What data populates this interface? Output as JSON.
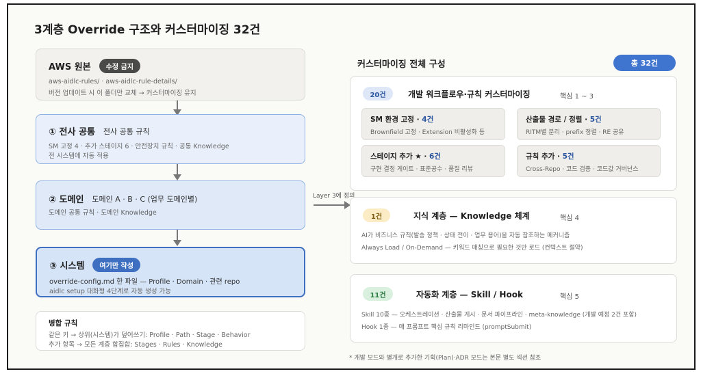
{
  "title": "3계층 Override 구조와 커스터마이징 32건",
  "layers": [
    {
      "name": "AWS 원본",
      "badge": "수정 금지",
      "subtitle": "",
      "lines": [
        "aws-aidlc-rules/ · aws-aidlc-rule-details/",
        "버전 업데이트 시 이 폴더만 교체 → 커스터마이징 유지"
      ]
    },
    {
      "name": "① 전사 공통",
      "badge": "",
      "subtitle": "전사 공통 규칙",
      "lines": [
        "SM 고정 4 · 추가 스테이지 6 · 안전장치 규칙 · 공통 Knowledge",
        "전 시스템에 자동 적용"
      ]
    },
    {
      "name": "② 도메인",
      "badge": "",
      "subtitle": "도메인 A · B · C (업무 도메인별)",
      "lines": [
        "도메인 공통 규칙 · 도메인 Knowledge"
      ]
    },
    {
      "name": "③ 시스템",
      "badge": "여기만 작성",
      "subtitle": "",
      "lines": [
        "override-config.md 한 파일 — Profile · Domain · 관련 repo",
        "aidlc setup 대화형 4단계로 자동 생성 가능"
      ]
    }
  ],
  "merge": {
    "title": "병합 규칙",
    "lines": [
      "같은 키 → 상위(시스템)가 덮어쓰기: Profile · Path · Stage · Behavior",
      "추가 항목 → 모든 계층 합집합: Stages · Rules · Knowledge"
    ]
  },
  "connector_label": "Layer 3에 정의",
  "right": {
    "title": "커스터마이징 전체 구성",
    "total": "총 32건",
    "sections": [
      {
        "count": "20건",
        "name": "개발 워크플로우·규칙 커스터마이징",
        "core": "핵심 1 ~ 3",
        "items": [
          {
            "title": "SM 환경 고정 · ",
            "count": "4건",
            "desc": "Brownfield 고정 · Extension 비활성화 등"
          },
          {
            "title": "산출물 경로 / 정렬 · ",
            "count": "5건",
            "desc": "RITM별 분리 · prefix 정렬 · RE 공유"
          },
          {
            "title": "스테이지 추가 ★ · ",
            "count": "6건",
            "desc": "구현 결정 게이트 · 표준공수 · 품질 리뷰"
          },
          {
            "title": "규칙 추가 · ",
            "count": "5건",
            "desc": "Cross-Repo · 코드 검증 · 코드값 거버넌스"
          }
        ]
      },
      {
        "count": "1건",
        "name": "지식 계층 — Knowledge 체계",
        "core": "핵심 4",
        "lines": [
          "AI가 비즈니스 규칙(발송 정책 · 상태 전이 · 업무 용어)을 자동 참조하는 메커니즘",
          "Always Load / On-Demand — 키워드 매칭으로 필요한 것만 로드 (컨텍스트 절약)"
        ]
      },
      {
        "count": "11건",
        "name": "자동화 계층 — Skill / Hook",
        "core": "핵심 5",
        "lines": [
          "Skill 10종 — 오케스트레이션 · 산출물 게시 · 문서 파이프라인 · meta-knowledge (개발 예정 2건 포함)",
          "Hook 1종 — 매 프롬프트 핵심 규칙 리마인드 (promptSubmit)"
        ]
      }
    ]
  },
  "footnote": "* 개발 모드와 별개로 추가한 기획(Plan)·ADR 모드는 본문 별도 섹션 참조"
}
